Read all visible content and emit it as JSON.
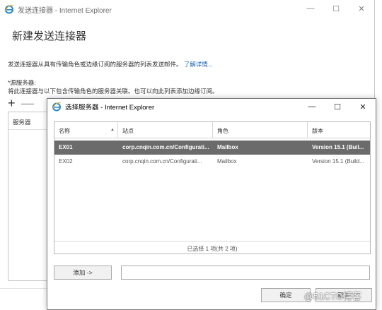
{
  "outer_window": {
    "title": "发送连接器 - Internet Explorer",
    "controls": [
      "—",
      "☐",
      "✕"
    ]
  },
  "page": {
    "heading": "新建发送连接器",
    "description": "发送连接器从具有传输角色或边缘订阅的服务器的列表发送邮件。",
    "more_link": "了解详情...",
    "source_label": "*源服务器:",
    "source_desc": "将此连接器与以下包含传输角色的服务器关联。也可以向此列表添加边缘订阅。",
    "add_symbol": "+",
    "remove_symbol": "—",
    "server_column": "服务器"
  },
  "dialog": {
    "title": "选择服务器 - Internet Explorer",
    "controls": [
      "—",
      "☐",
      "✕"
    ],
    "columns": [
      "名称",
      "站点",
      "角色",
      "版本"
    ],
    "sort_indicator": "▲",
    "rows": [
      {
        "name": "EX01",
        "site": "corp.cnqin.com.cn/Configurati...",
        "role": "Mailbox",
        "version": "Version 15.1 (Buil...",
        "selected": true
      },
      {
        "name": "EX02",
        "site": "corp.cnqin.com.cn/Configurati...",
        "role": "Mailbox",
        "version": "Version 15.1 (Build...",
        "selected": false
      }
    ],
    "status": "已选择 1 项(共 2 项)",
    "add_button": "添加 ->",
    "add_field_value": "",
    "ok_button": "确定",
    "cancel_button": "取消"
  },
  "watermark": "@51CTO博客",
  "colors": {
    "link": "#1a64b8",
    "selected_row": "#6b6b6b",
    "ie_icon": "#1e88d8"
  }
}
